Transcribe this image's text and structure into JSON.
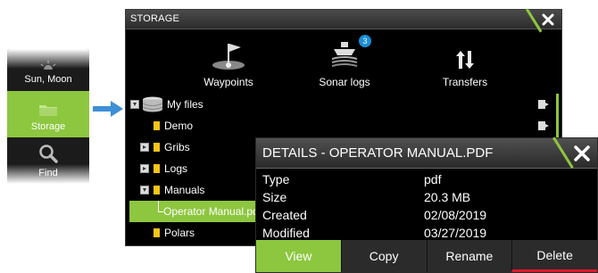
{
  "side_menu": {
    "items": [
      {
        "label": "Sun, Moon",
        "icon": "sun-moon-icon"
      },
      {
        "label": "Storage",
        "icon": "folder-icon"
      },
      {
        "label": "Find",
        "icon": "magnifier-icon"
      }
    ]
  },
  "storage_window": {
    "title": "STORAGE",
    "close_icon": "close-icon",
    "toolbar": [
      {
        "label": "Waypoints",
        "icon": "waypoint-flag-icon"
      },
      {
        "label": "Sonar logs",
        "icon": "sonar-boat-icon",
        "badge": "3"
      },
      {
        "label": "Transfers",
        "icon": "transfer-arrows-icon"
      }
    ],
    "tree": [
      {
        "label": "My files",
        "type": "root"
      },
      {
        "label": "Demo",
        "type": "folder"
      },
      {
        "label": "Gribs",
        "type": "folder"
      },
      {
        "label": "Logs",
        "type": "folder"
      },
      {
        "label": "Manuals",
        "type": "folder"
      },
      {
        "label": "Operator Manual.pdf",
        "type": "file",
        "selected": true
      },
      {
        "label": "Polars",
        "type": "folder"
      }
    ]
  },
  "details_dialog": {
    "title": "DETAILS - OPERATOR MANUAL.PDF",
    "properties": [
      {
        "key": "Type",
        "value": "pdf"
      },
      {
        "key": "Size",
        "value": "20.3 MB"
      },
      {
        "key": "Created",
        "value": "02/08/2019"
      },
      {
        "key": "Modified",
        "value": "03/27/2019"
      }
    ],
    "buttons": [
      "View",
      "Copy",
      "Rename",
      "Delete"
    ]
  },
  "colors": {
    "accent": "#8dc63f",
    "badge": "#1a8fd9",
    "delete": "#e0182d",
    "folder": "#f5c518"
  }
}
